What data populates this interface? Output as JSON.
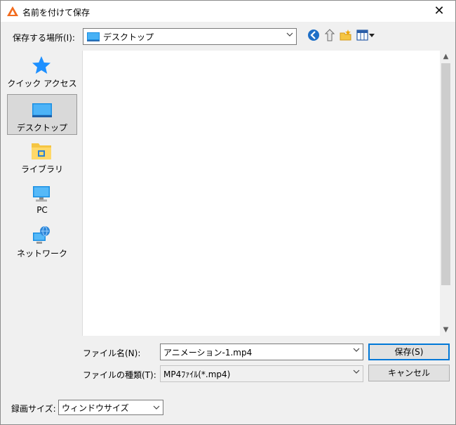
{
  "window": {
    "title": "名前を付けて保存",
    "close_glyph": "✕"
  },
  "save_in": {
    "label": "保存する場所(I):",
    "value": "デスクトップ"
  },
  "toolbar": [
    "back-icon",
    "up-folder-icon",
    "new-folder-icon",
    "view-menu-icon"
  ],
  "places": [
    {
      "label": "クイック アクセス",
      "icon": "star-icon"
    },
    {
      "label": "デスクトップ",
      "icon": "desktop-icon",
      "selected": true
    },
    {
      "label": "ライブラリ",
      "icon": "library-icon"
    },
    {
      "label": "PC",
      "icon": "pc-icon"
    },
    {
      "label": "ネットワーク",
      "icon": "network-icon"
    }
  ],
  "filename": {
    "label": "ファイル名(N):",
    "value": "アニメーション-1.mp4"
  },
  "filetype": {
    "label": "ファイルの種類(T):",
    "value": "MP4ﾌｧｲﾙ(*.mp4)"
  },
  "buttons": {
    "save": "保存(S)",
    "cancel": "キャンセル"
  },
  "record_size": {
    "label": "録画サイズ:",
    "value": "ウィンドウサイズ"
  },
  "colors": {
    "accent": "#0078d7",
    "selection": "#d9d9d9"
  }
}
